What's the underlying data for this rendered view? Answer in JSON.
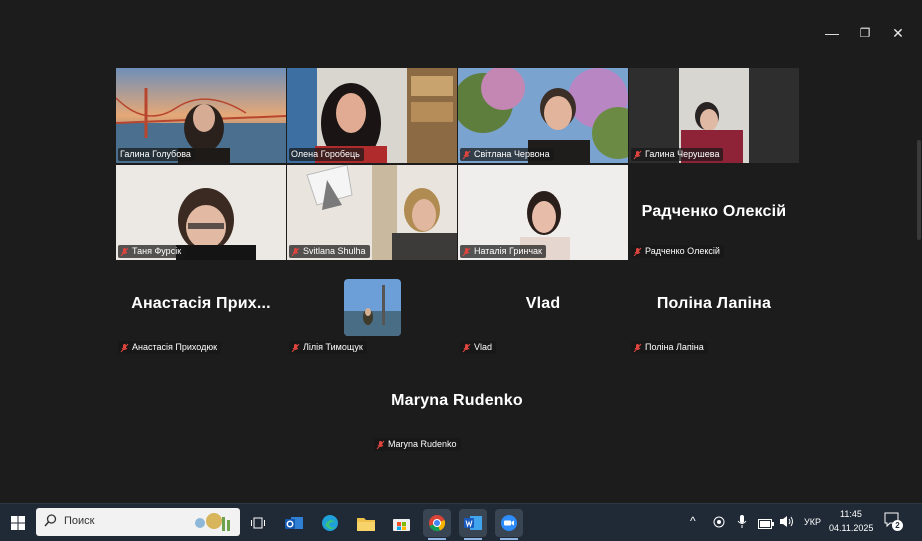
{
  "window": {
    "controls": {
      "minimize": "—",
      "restore": "❐",
      "close": "✕"
    }
  },
  "participants": {
    "row1": [
      {
        "name": "Галина Голубова"
      },
      {
        "name": "Олена Горобець"
      },
      {
        "name": "Світлана Червона"
      },
      {
        "name": "Галина Черушева"
      }
    ],
    "row2": [
      {
        "name": "Таня Фурсік"
      },
      {
        "name": "Svitlana Shulha"
      },
      {
        "name": "Наталія Гринчак"
      },
      {
        "name": "Радченко Олексій",
        "display": "Радченко Олексій"
      }
    ],
    "row3": [
      {
        "name": "Анастасія Приходюк",
        "display": "Анастасія  Прих..."
      },
      {
        "name": "Лілія Тимощук"
      },
      {
        "name": "Vlad",
        "display": "Vlad"
      },
      {
        "name": "Поліна Лапіна",
        "display": "Поліна Лапіна"
      }
    ],
    "row4": [
      {
        "name": "Maryna Rudenko",
        "display": "Maryna Rudenko"
      }
    ]
  },
  "taskbar": {
    "search_placeholder": "Поиск",
    "icons": [
      "windows-start-icon",
      "search-icon",
      "task-view-icon",
      "outlook-icon",
      "edge-icon",
      "file-explorer-icon",
      "microsoft-store-icon",
      "chrome-icon",
      "word-icon",
      "zoom-icon"
    ],
    "tray": {
      "chevron": "^",
      "language": "УКР",
      "time": "11:45",
      "date": "04.11.2025",
      "notifications": "2"
    }
  },
  "colors": {
    "active_speaker": "#41b36a",
    "muted_mic": "#e0453e",
    "taskbar": "#202a36",
    "background": "#1c1c1c"
  }
}
